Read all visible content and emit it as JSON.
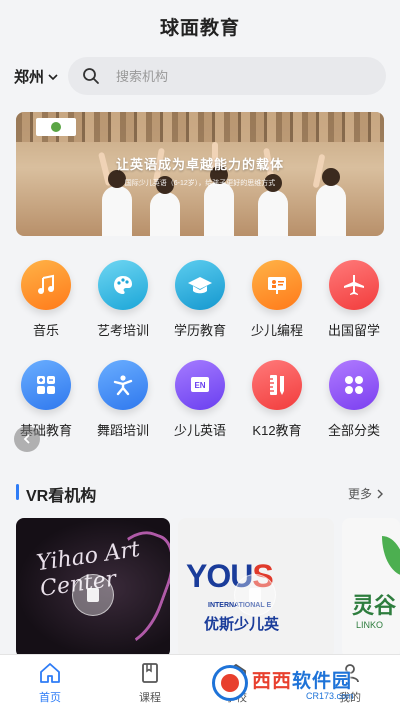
{
  "app": {
    "title": "球面教育"
  },
  "search": {
    "city": "郑州",
    "placeholder": "搜索机构"
  },
  "banner": {
    "headline": "让英语成为卓越能力的载体",
    "subline": "国际少儿英语（6-12岁），给孩子更好的思维方式"
  },
  "categories": [
    {
      "label": "音乐",
      "icon": "music-note-icon",
      "color": "#ff8a2b"
    },
    {
      "label": "艺考培训",
      "icon": "palette-icon",
      "color": "#2fb7e0"
    },
    {
      "label": "学历教育",
      "icon": "graduation-cap-icon",
      "color": "#23a9d9"
    },
    {
      "label": "少儿编程",
      "icon": "presentation-board-icon",
      "color": "#ff8a2b"
    },
    {
      "label": "出国留学",
      "icon": "airplane-icon",
      "color": "#ff4a4a"
    },
    {
      "label": "基础教育",
      "icon": "calculator-icon",
      "color": "#3a8cf5"
    },
    {
      "label": "舞蹈培训",
      "icon": "dancer-icon",
      "color": "#3a8cf5"
    },
    {
      "label": "少儿英语",
      "icon": "en-book-icon",
      "color": "#7b4df2"
    },
    {
      "label": "K12教育",
      "icon": "ruler-pen-icon",
      "color": "#ff4a4a"
    },
    {
      "label": "全部分类",
      "icon": "grid-dots-icon",
      "color": "#8a4df2"
    }
  ],
  "vr_section": {
    "title": "VR看机构",
    "more": "更多"
  },
  "vr_cards": [
    {
      "brand": "Yihao Art Center"
    },
    {
      "brand": "YOUS",
      "brand_highlight": "S",
      "intl": "INTERNATIONAL E",
      "cn": "优斯少儿英"
    },
    {
      "brand": "灵谷",
      "sub": "LINKO"
    }
  ],
  "tabbar": [
    {
      "label": "首页",
      "icon": "home-icon",
      "active": true
    },
    {
      "label": "课程",
      "icon": "book-icon",
      "active": false
    },
    {
      "label": "学校",
      "icon": "school-icon",
      "active": false
    },
    {
      "label": "我的",
      "icon": "user-icon",
      "active": false
    }
  ],
  "watermark": {
    "text_a": "西西",
    "text_b": "软件园",
    "url": "CR173.com"
  },
  "colors": {
    "accent": "#2e7cf6",
    "background": "#f3f4f6"
  }
}
